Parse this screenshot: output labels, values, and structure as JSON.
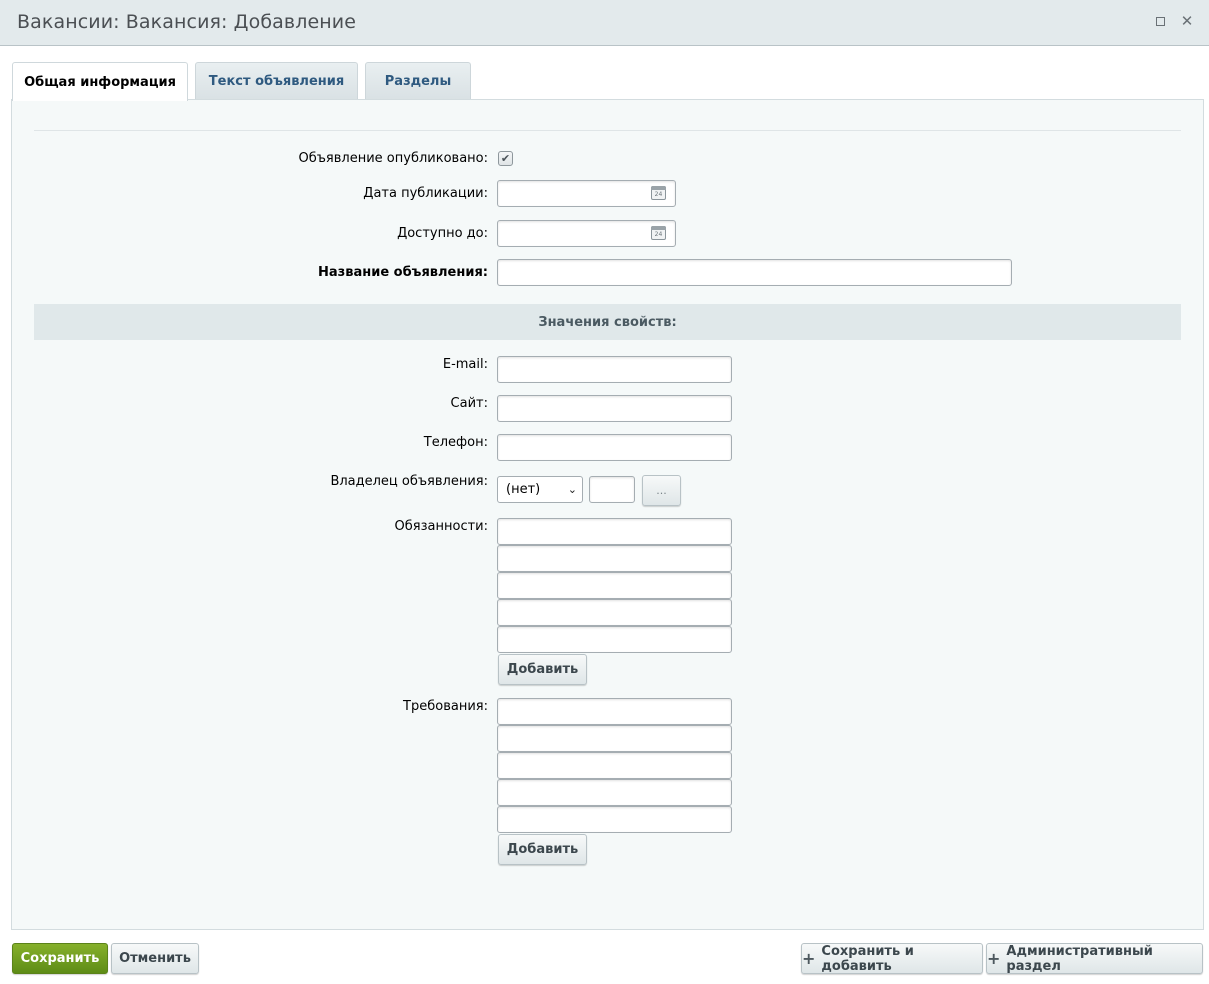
{
  "window": {
    "title": "Вакансии: Вакансия: Добавление"
  },
  "tabs": [
    {
      "label": "Общая информация",
      "active": true
    },
    {
      "label": "Текст объявления",
      "active": false
    },
    {
      "label": "Разделы",
      "active": false
    }
  ],
  "form": {
    "published_label": "Объявление опубликовано:",
    "published_checked": true,
    "pub_date_label": "Дата публикации:",
    "pub_date_value": "",
    "available_until_label": "Доступно до:",
    "available_until_value": "",
    "name_label": "Название объявления:",
    "name_value": "",
    "calendar_icon_text": "24"
  },
  "properties": {
    "header": "Значения свойств:",
    "email_label": "E-mail:",
    "site_label": "Сайт:",
    "phone_label": "Телефон:",
    "owner_label": "Владелец объявления:",
    "owner_selected": "(нет)",
    "owner_browse_label": "...",
    "duties_label": "Обязанности:",
    "requirements_label": "Требования:",
    "add_label": "Добавить"
  },
  "footer": {
    "save": "Сохранить",
    "cancel": "Отменить",
    "save_and_add": "Сохранить и добавить",
    "admin_section": "Административный раздел"
  },
  "colors": {
    "primary_button": "#6f9b1f",
    "titlebar": "#e3eaec",
    "panel_bg": "#f5f9f9",
    "section_bar": "#e0e8ea",
    "tab_text": "#2f5a80"
  }
}
